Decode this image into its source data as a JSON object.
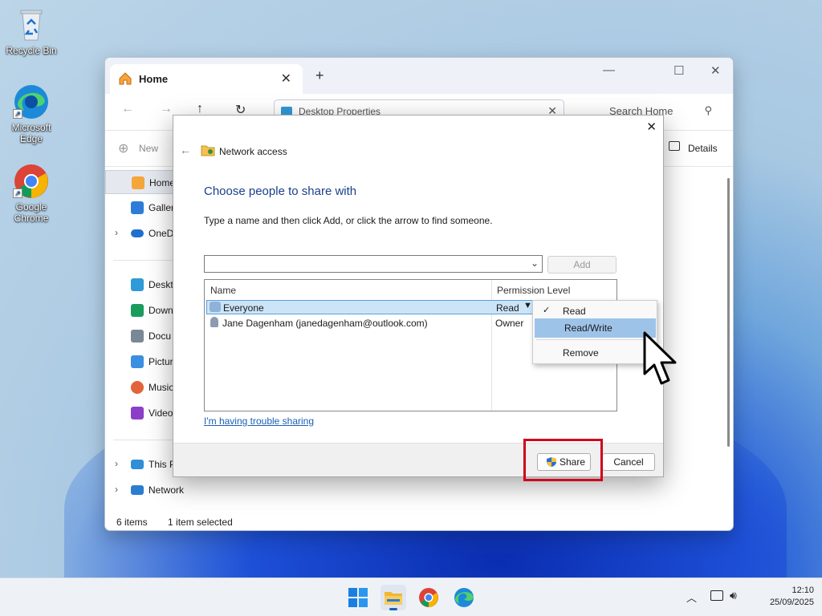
{
  "desktop": {
    "icons": [
      {
        "label": "Recycle Bin",
        "icon": "recycle-bin-icon"
      },
      {
        "label": "Microsoft Edge",
        "icon": "edge-icon"
      },
      {
        "label": "Google Chrome",
        "icon": "chrome-icon"
      }
    ]
  },
  "explorer": {
    "tab_title": "Home",
    "address": "Desktop Properties",
    "search_placeholder": "Search Home",
    "toolbar": {
      "new_label": "New",
      "details_label": "Details"
    },
    "sidebar": [
      {
        "label": "Home",
        "icon": "home-icon"
      },
      {
        "label": "Galler",
        "icon": "gallery-icon"
      },
      {
        "label": "OneD",
        "icon": "onedrive-icon"
      },
      {
        "label": "Deskt",
        "icon": "desktop-folder-icon"
      },
      {
        "label": "Down",
        "icon": "downloads-icon"
      },
      {
        "label": "Docu",
        "icon": "documents-icon"
      },
      {
        "label": "Pictur",
        "icon": "pictures-icon"
      },
      {
        "label": "Music",
        "icon": "music-icon"
      },
      {
        "label": "Video",
        "icon": "videos-icon"
      },
      {
        "label": "This P",
        "icon": "this-pc-icon"
      },
      {
        "label": "Network",
        "icon": "network-icon"
      }
    ],
    "status": {
      "items": "6 items",
      "selected": "1 item selected"
    }
  },
  "dialog": {
    "title": "Network access",
    "heading": "Choose people to share with",
    "instructions": "Type a name and then click Add, or click the arrow to find someone.",
    "name_input_value": "",
    "add_label": "Add",
    "columns": {
      "name": "Name",
      "permission": "Permission Level"
    },
    "rows": [
      {
        "name": "Everyone",
        "permission": "Read"
      },
      {
        "name": "Jane Dagenham (janedagenham@outlook.com)",
        "permission": "Owner"
      }
    ],
    "trouble_link": "I'm having trouble sharing",
    "share_label": "Share",
    "cancel_label": "Cancel"
  },
  "permission_menu": {
    "items": [
      {
        "label": "Read",
        "checked": true
      },
      {
        "label": "Read/Write",
        "highlighted": true
      },
      {
        "label": "Remove"
      }
    ]
  },
  "taskbar": {
    "time": "12:10",
    "date": "25/09/2025",
    "apps": [
      "start-icon",
      "file-explorer-icon",
      "chrome-icon",
      "edge-icon"
    ]
  },
  "colors": {
    "accent": "#1a5fb4",
    "highlight_box": "#d0021b",
    "menu_hover": "#9ec3e8"
  }
}
